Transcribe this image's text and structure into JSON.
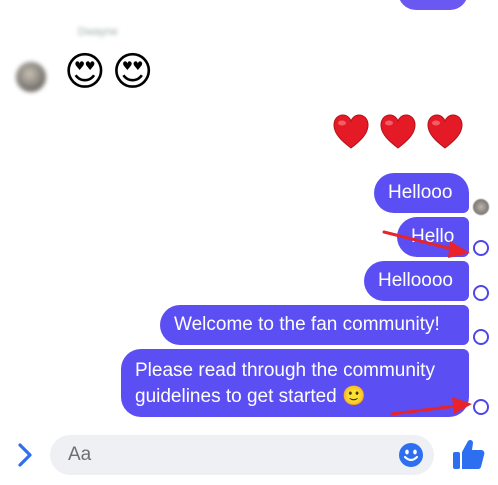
{
  "chat": {
    "top_sender_name": "Dwayne",
    "received_emojis": [
      "😍",
      "😍"
    ],
    "hearts": [
      "❤",
      "❤",
      "❤"
    ],
    "messages": [
      {
        "text": "Hellooo"
      },
      {
        "text": "Hello"
      },
      {
        "text": "Helloooo"
      },
      {
        "text": "Welcome to the fan community!"
      },
      {
        "text_line1": "Please read through the community",
        "text_line2": "guidelines to get started 🙂"
      }
    ]
  },
  "composer": {
    "placeholder": "Aa",
    "expand_icon": "chevron-right-icon",
    "emoji_icon": "smiley-icon",
    "like_icon": "thumbs-up-icon"
  },
  "colors": {
    "bubble": "#5b4ff4",
    "accent": "#2d6ff0",
    "annotation": "#e8232b"
  }
}
